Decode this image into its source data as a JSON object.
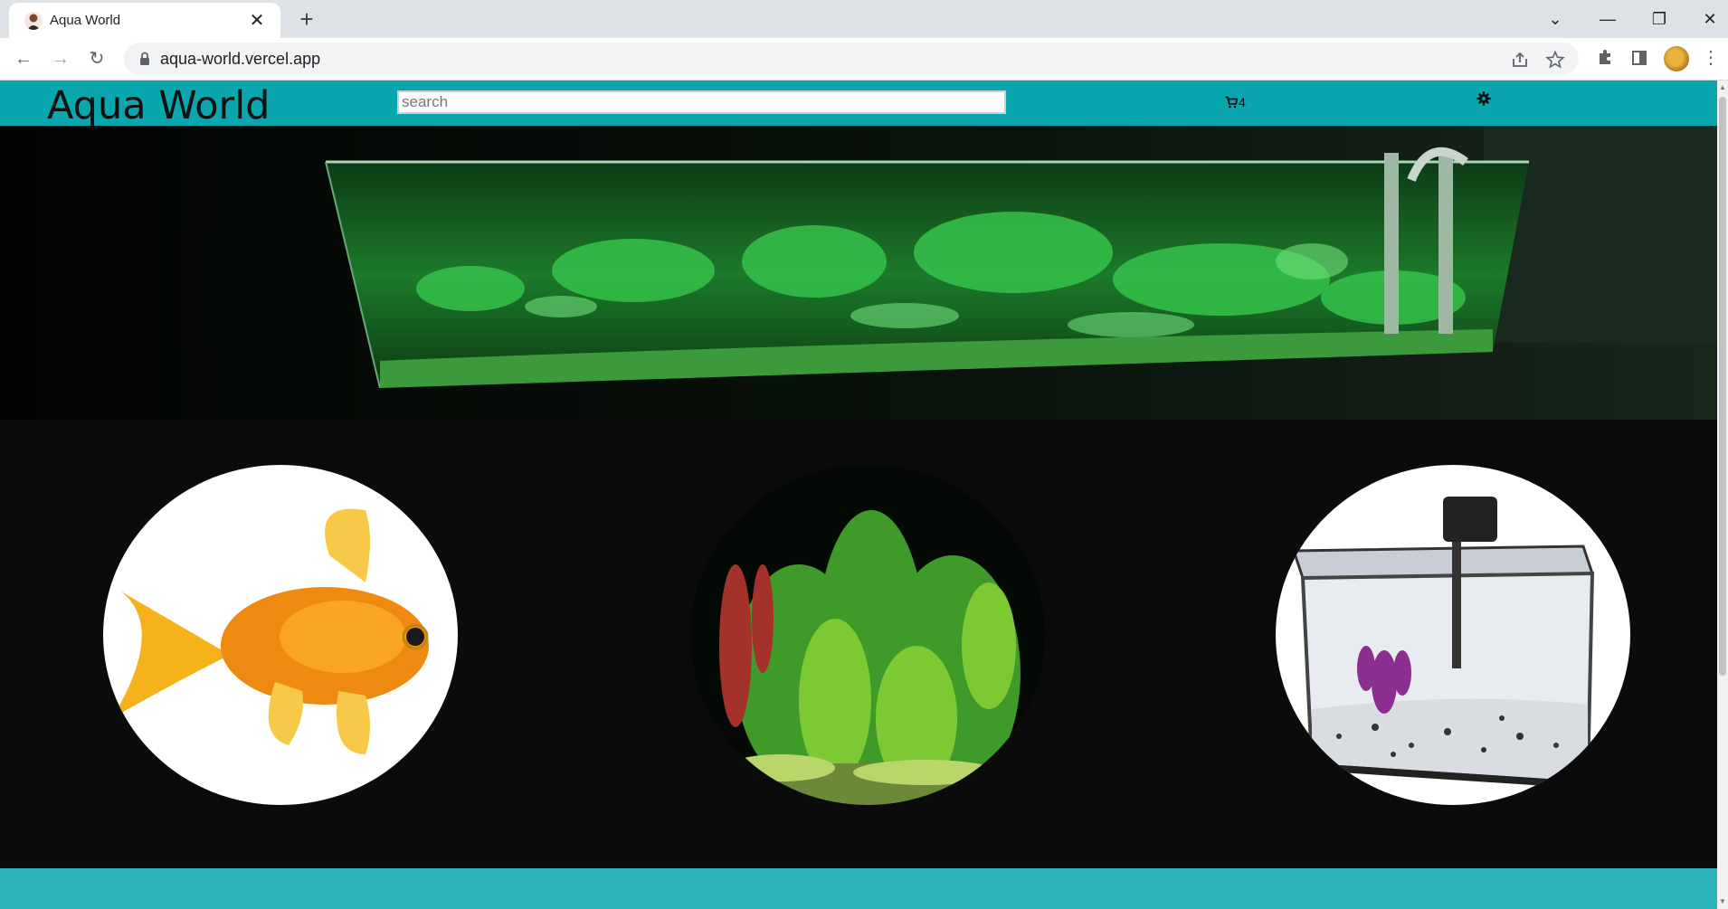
{
  "browser": {
    "tab_title": "Aqua World",
    "tab_close": "✕",
    "new_tab": "+",
    "url": "aqua-world.vercel.app",
    "controls": {
      "dropdown": "⌄",
      "minimize": "—",
      "restore": "❐",
      "close": "✕"
    },
    "nav": {
      "back": "←",
      "forward": "→",
      "reload": "↻"
    },
    "menu": "⋮"
  },
  "site": {
    "logo": "Aqua World",
    "search_placeholder": "search",
    "cart_count": "4",
    "header_color": "#0aa6ad",
    "footer_color": "#2ab3ba",
    "categories": [
      {
        "name": "goldfish",
        "icon": "goldfish-image"
      },
      {
        "name": "aquatic-plants",
        "icon": "aquatic-plants-image"
      },
      {
        "name": "aquarium-tank",
        "icon": "aquarium-tank-image"
      }
    ]
  }
}
